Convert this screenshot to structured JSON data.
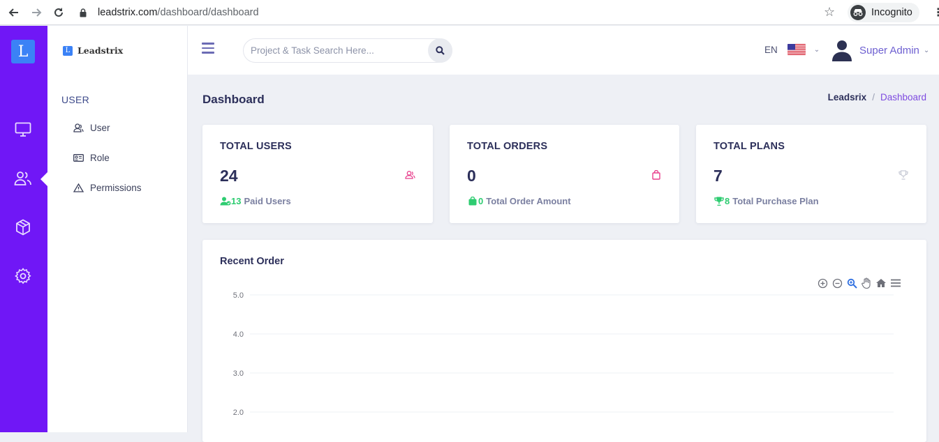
{
  "browser": {
    "url_domain": "leadstrix.com",
    "url_path": "/dashboard/dashboard",
    "incognito_label": "Incognito"
  },
  "rail": {
    "logo_letter": "L",
    "items": [
      {
        "icon": "monitor-icon"
      },
      {
        "icon": "users-icon",
        "active": true
      },
      {
        "icon": "cube-icon"
      },
      {
        "icon": "gear-icon"
      }
    ],
    "accent_color": "#7017f6"
  },
  "subnav": {
    "brand_letter": "L",
    "brand_name": "Leadstrix",
    "section_title": "USER",
    "items": [
      {
        "label": "User",
        "icon": "user-icon"
      },
      {
        "label": "Role",
        "icon": "id-card-icon"
      },
      {
        "label": "Permissions",
        "icon": "warning-icon"
      }
    ]
  },
  "header": {
    "search_placeholder": "Project & Task Search Here...",
    "language": "EN",
    "user_name": "Super Admin"
  },
  "page": {
    "title": "Dashboard",
    "breadcrumb_root": "Leadsrix",
    "breadcrumb_sep": "/",
    "breadcrumb_current": "Dashboard"
  },
  "cards": [
    {
      "title": "TOTAL USERS",
      "value": "24",
      "foot_num": "13",
      "foot_label": "Paid Users",
      "icon_color": "#e83e8c",
      "foot_icon": "user-check-icon"
    },
    {
      "title": "TOTAL ORDERS",
      "value": "0",
      "foot_num": "0",
      "foot_label": "Total Order Amount",
      "icon_color": "#e83e8c",
      "foot_icon": "shopping-bag-icon"
    },
    {
      "title": "TOTAL PLANS",
      "value": "7",
      "foot_num": "8",
      "foot_label": "Total Purchase Plan",
      "icon_color": "#c8cbd6",
      "foot_icon": "trophy-icon"
    }
  ],
  "recent_order": {
    "title": "Recent Order",
    "toolbar": [
      "zoom-in-icon",
      "zoom-out-icon",
      "magnify-icon",
      "pan-hand-icon",
      "home-icon",
      "menu-icon"
    ]
  },
  "chart_data": {
    "type": "line",
    "title": "Recent Order",
    "series": [],
    "ylim": [
      2.0,
      5.0
    ],
    "yticks": [
      "5.0",
      "4.0",
      "3.0",
      "2.0"
    ],
    "grid": true
  }
}
